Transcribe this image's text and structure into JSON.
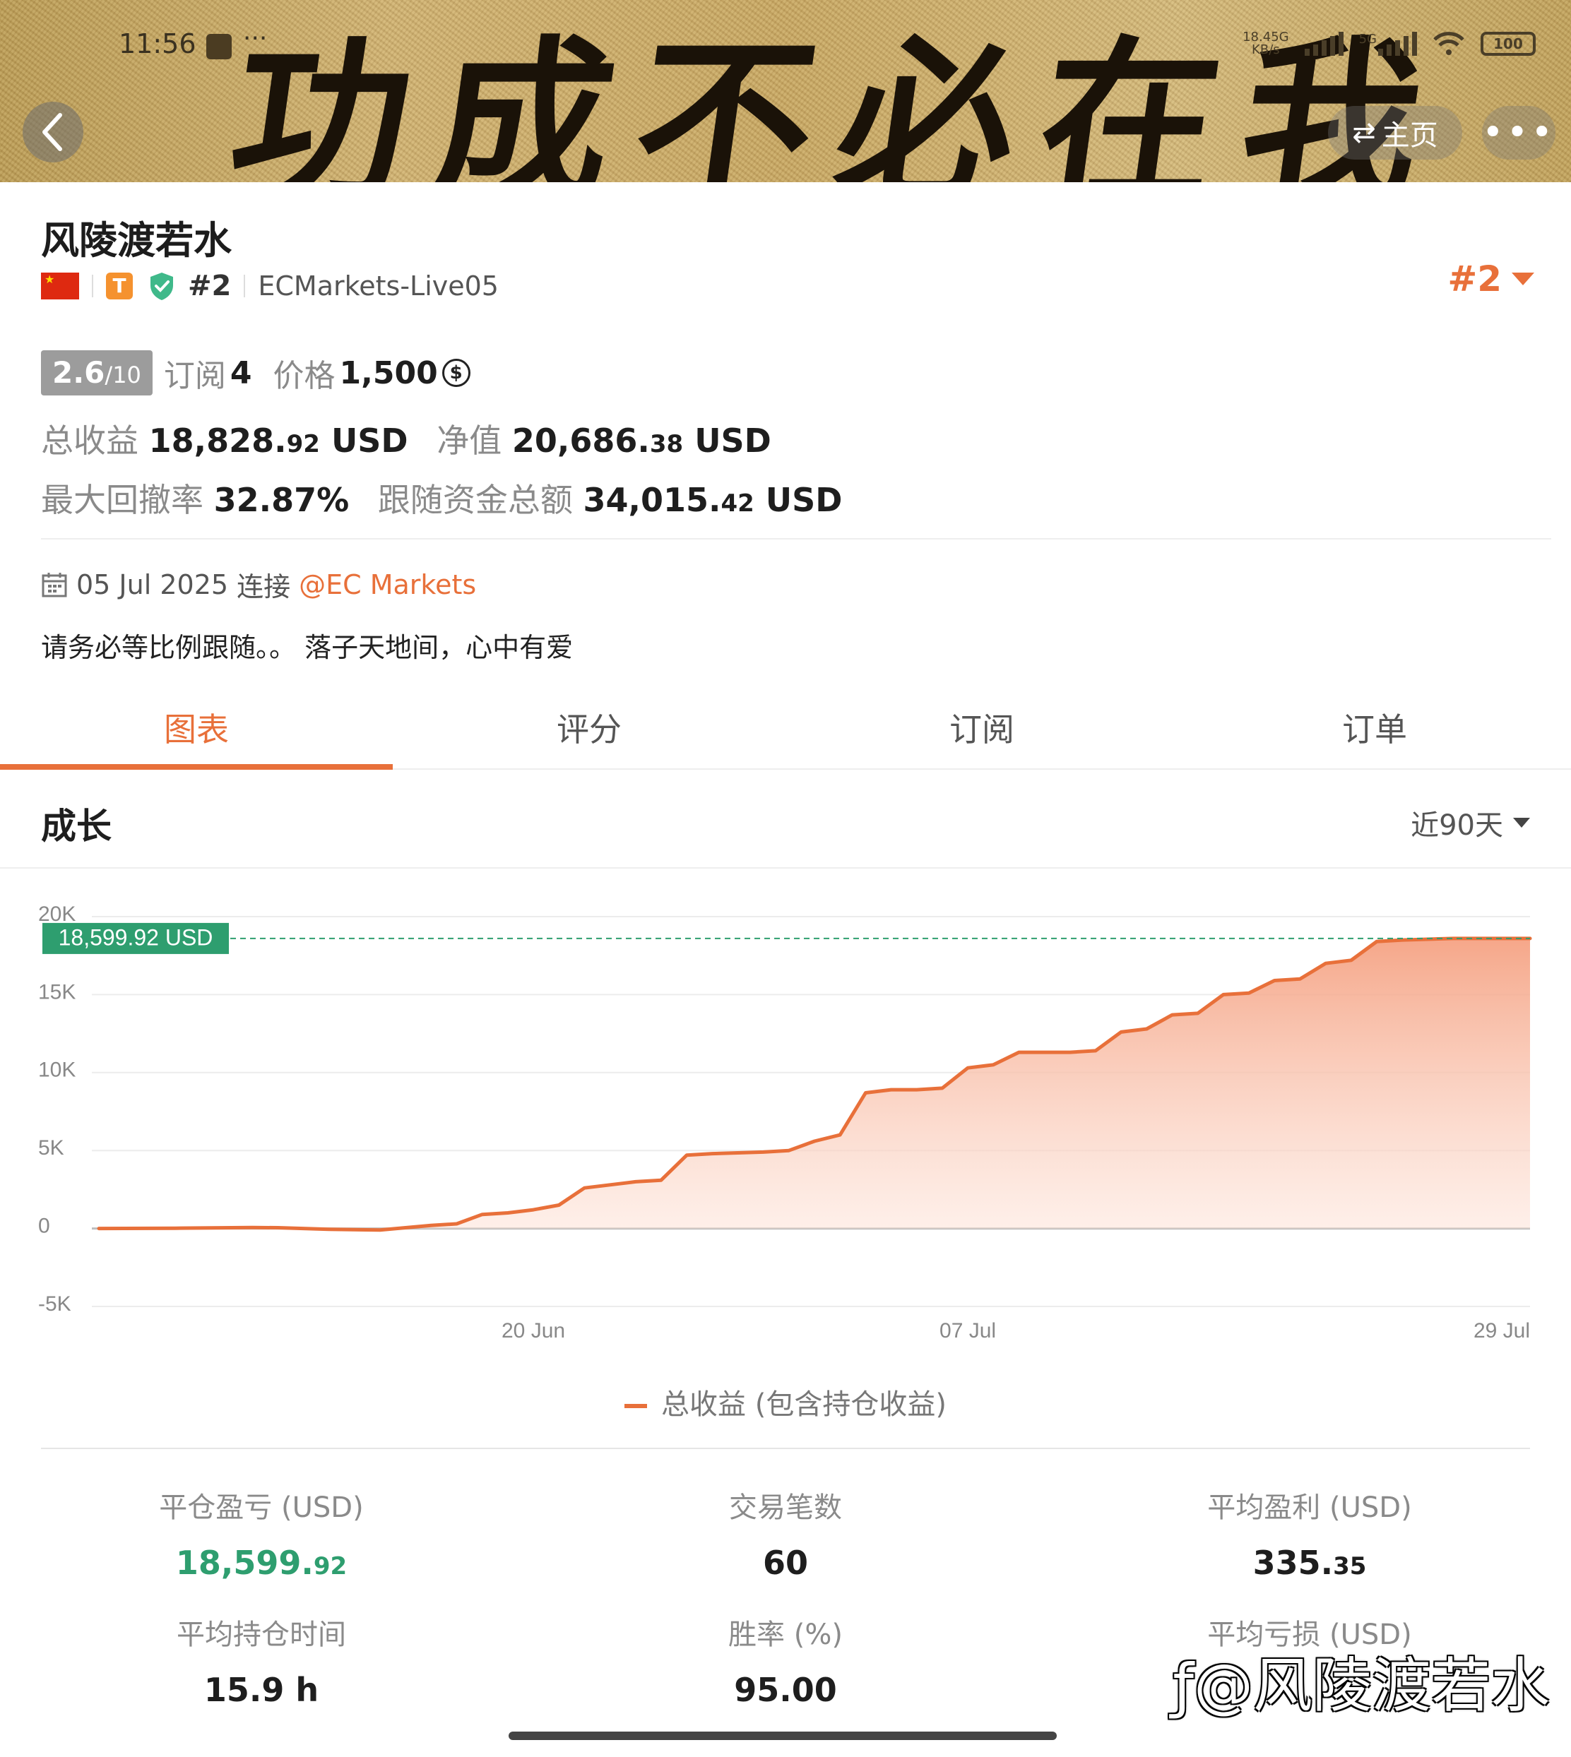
{
  "status_bar": {
    "time": "11:56",
    "more": "···",
    "net_speed": "18.45G KB/s",
    "net_top": "18.45G",
    "net_bottom": "KB/s",
    "network": "5G",
    "battery": "100"
  },
  "banner": {
    "calligraphy": "功成不必在我"
  },
  "nav": {
    "home_label": "主页",
    "more_label": "•••"
  },
  "profile": {
    "name": "风陵渡若水",
    "badge_letter": "T",
    "rank": "#2",
    "server": "ECMarkets-Live05",
    "rank_dropdown": "#2"
  },
  "stats": {
    "score_main": "2.6",
    "score_den": "/10",
    "subscribe_label": "订阅",
    "subscribe_value": "4",
    "price_label": "价格",
    "price_value": "1,500",
    "coin_symbol": "$",
    "total_profit_label": "总收益",
    "total_profit_int": "18,828.",
    "total_profit_dec": "92",
    "total_profit_unit": "USD",
    "equity_label": "净值",
    "equity_int": "20,686.",
    "equity_dec": "38",
    "equity_unit": "USD",
    "drawdown_label": "最大回撤率",
    "drawdown_value": "32.87%",
    "follow_label": "跟随资金总额",
    "follow_int": "34,015.",
    "follow_dec": "42",
    "follow_unit": "USD"
  },
  "connect": {
    "date": "05 Jul 2025",
    "verb": "连接",
    "link": "@EC Markets"
  },
  "description": "请务必等比例跟随。。 落子天地间，心中有爱",
  "tabs": [
    {
      "label": "图表",
      "active": true
    },
    {
      "label": "评分",
      "active": false
    },
    {
      "label": "订阅",
      "active": false
    },
    {
      "label": "订单",
      "active": false
    }
  ],
  "growth": {
    "title": "成长",
    "range": "近90天"
  },
  "chart_data": {
    "type": "area",
    "title": "",
    "ylim": [
      -5000,
      20000
    ],
    "y_ticks": [
      "20K",
      "15K",
      "10K",
      "5K",
      "0",
      "-5K"
    ],
    "x_ticks": [
      "20 Jun",
      "07 Jul",
      "29 Jul"
    ],
    "current_value_label": "18,599.92 USD",
    "current_value": 18599.92,
    "color": "#e8703a",
    "label_color": "#2e9e6f",
    "series": [
      {
        "name": "总收益 (包含持仓收益)",
        "points": [
          [
            "2025-06-03",
            0
          ],
          [
            "2025-06-06",
            20
          ],
          [
            "2025-06-09",
            60
          ],
          [
            "2025-06-10",
            50
          ],
          [
            "2025-06-12",
            -50
          ],
          [
            "2025-06-14",
            -100
          ],
          [
            "2025-06-15",
            50
          ],
          [
            "2025-06-16",
            200
          ],
          [
            "2025-06-17",
            300
          ],
          [
            "2025-06-18",
            900
          ],
          [
            "2025-06-19",
            1000
          ],
          [
            "2025-06-20",
            1200
          ],
          [
            "2025-06-21",
            1500
          ],
          [
            "2025-06-22",
            2600
          ],
          [
            "2025-06-23",
            2800
          ],
          [
            "2025-06-24",
            3000
          ],
          [
            "2025-06-25",
            3100
          ],
          [
            "2025-06-26",
            4700
          ],
          [
            "2025-06-27",
            4800
          ],
          [
            "2025-06-29",
            4900
          ],
          [
            "2025-06-30",
            5000
          ],
          [
            "2025-07-01",
            5600
          ],
          [
            "2025-07-02",
            6000
          ],
          [
            "2025-07-03",
            8700
          ],
          [
            "2025-07-04",
            8900
          ],
          [
            "2025-07-05",
            8900
          ],
          [
            "2025-07-06",
            9000
          ],
          [
            "2025-07-07",
            10300
          ],
          [
            "2025-07-08",
            10500
          ],
          [
            "2025-07-09",
            11300
          ],
          [
            "2025-07-10",
            11300
          ],
          [
            "2025-07-11",
            11300
          ],
          [
            "2025-07-12",
            11400
          ],
          [
            "2025-07-13",
            12600
          ],
          [
            "2025-07-14",
            12800
          ],
          [
            "2025-07-15",
            13700
          ],
          [
            "2025-07-16",
            13800
          ],
          [
            "2025-07-17",
            15000
          ],
          [
            "2025-07-18",
            15100
          ],
          [
            "2025-07-19",
            15900
          ],
          [
            "2025-07-20",
            16000
          ],
          [
            "2025-07-21",
            17000
          ],
          [
            "2025-07-22",
            17200
          ],
          [
            "2025-07-23",
            18400
          ],
          [
            "2025-07-24",
            18500
          ],
          [
            "2025-07-26",
            18600
          ],
          [
            "2025-07-29",
            18600
          ]
        ]
      }
    ]
  },
  "legend_label": "总收益 (包含持仓收益)",
  "bottom_stats": [
    {
      "label": "平仓盈亏 (USD)",
      "value": "18,599.",
      "value_small": "92",
      "green": true
    },
    {
      "label": "交易笔数",
      "value": "60",
      "value_small": "",
      "green": false
    },
    {
      "label": "平均盈利 (USD)",
      "value": "335.",
      "value_small": "35",
      "green": false
    },
    {
      "label": "平均持仓时间",
      "value": "15.9 h",
      "value_small": "",
      "green": false
    },
    {
      "label": "胜率 (%)",
      "value": "95.00",
      "value_small": "",
      "green": false
    },
    {
      "label": "平均亏损 (USD)",
      "value": "",
      "value_small": "",
      "green": false
    }
  ],
  "watermark": "@风陵渡若水"
}
